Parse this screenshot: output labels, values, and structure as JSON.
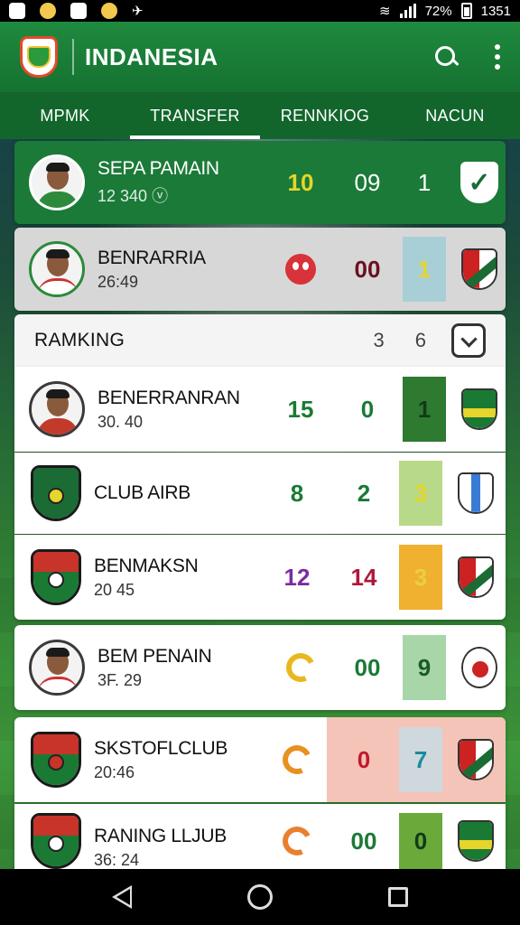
{
  "status_bar": {
    "battery": "72%",
    "time": "1351"
  },
  "app_bar": {
    "title": "INDANESIA"
  },
  "tabs": [
    {
      "label": "MPMK",
      "active": false
    },
    {
      "label": "TRANSFER",
      "active": true
    },
    {
      "label": "RENNKIOG",
      "active": false
    },
    {
      "label": "NACUN",
      "active": false
    }
  ],
  "featured": {
    "name": "SEPA PAMAIN",
    "sub": "12 340",
    "n1": "10",
    "n2": "09",
    "n3": "1",
    "badge": "check-shield-icon"
  },
  "second": {
    "name": "BENRARRIA",
    "sub": "26:49",
    "n2": "00",
    "n3": "1"
  },
  "ranking": {
    "label": "RAMKING",
    "col_a": "3",
    "col_b": "6",
    "rows": [
      {
        "name": "BENERRANRAN",
        "sub": "30. 40",
        "n1": "15",
        "n2": "0",
        "n3": "1"
      },
      {
        "name": "CLUB AIRB",
        "sub": "",
        "n1": "8",
        "n2": "2",
        "n3": "3"
      },
      {
        "name": "BENMAKSN",
        "sub": "20 45",
        "n1": "12",
        "n2": "14",
        "n3": "3"
      },
      {
        "name": "BEM PENAIN",
        "sub": "3F. 29",
        "n2": "00",
        "n3": "9"
      },
      {
        "name": "SKSTOFLCLUB",
        "sub": "20:46",
        "n2": "0",
        "n3": "7"
      },
      {
        "name": "RANING LLJUB",
        "sub": "36: 24",
        "n2": "00",
        "n3": "0"
      }
    ]
  },
  "colors": {
    "primary_green": "#157231",
    "accent_yellow": "#e6d52a",
    "purple": "#7b2ca0",
    "crimson": "#b0163c"
  }
}
